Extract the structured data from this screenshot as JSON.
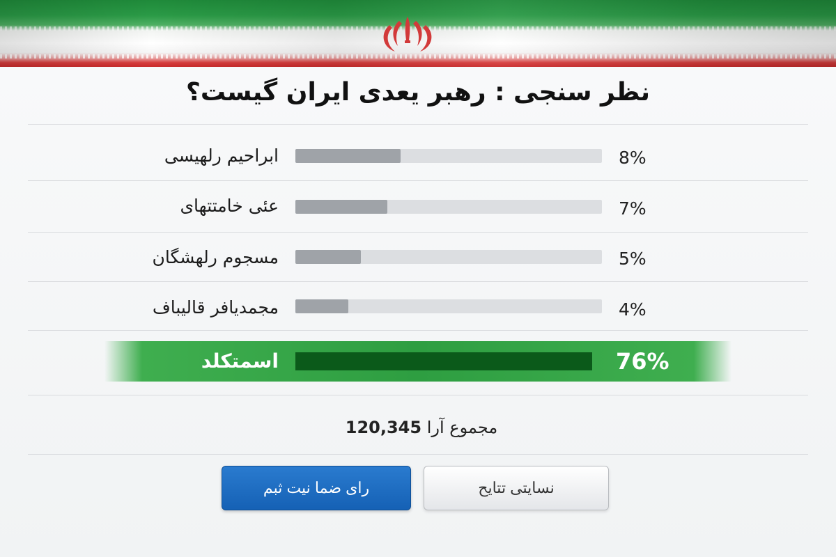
{
  "colors": {
    "flag_green": "#239a3f",
    "flag_red": "#d63c3c",
    "bar_gray": "#9fa3a8",
    "track_gray": "#dcdee1",
    "winner_green": "#2e9e41",
    "winner_bar": "#0b5a1a",
    "vote_button": "#1d6ec2"
  },
  "header": {
    "emblem_icon": "iran-emblem-icon"
  },
  "poll": {
    "title": "نظر سنجی : رهبر یعدی ایران گیست؟",
    "options": [
      {
        "label": "ابراحیم رلهیسی",
        "percent_text": "8%",
        "percent": 8
      },
      {
        "label": "عئی خامتتهای",
        "percent_text": "7%",
        "percent": 7
      },
      {
        "label": "مسجوم رلهشگان",
        "percent_text": "5%",
        "percent": 5
      },
      {
        "label": "مجمدیافر قالیباف",
        "percent_text": "4%",
        "percent": 4
      }
    ],
    "winner": {
      "label": "اسمتکلد",
      "percent_text": "76%",
      "percent": 76
    },
    "total_label": "مجموع آرا",
    "total_value": "120,345"
  },
  "buttons": {
    "vote_label": "رای ضما نیت ثبم",
    "results_label": "نسایتی تتایح"
  }
}
